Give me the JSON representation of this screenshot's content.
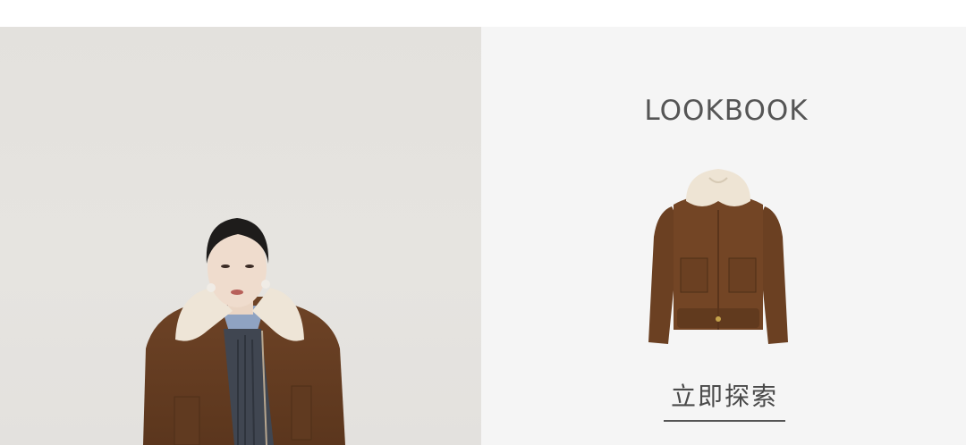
{
  "banner": {
    "title": "LOOKBOOK",
    "cta_label": "立即探索",
    "model_image_icon": "model-photo",
    "product_image_icon": "jacket-photo"
  },
  "colors": {
    "background_left": "#e4e2de",
    "background_right": "#f5f5f5",
    "title_text": "#555555",
    "jacket_brown": "#6b4022",
    "collar_cream": "#efe6d8"
  }
}
